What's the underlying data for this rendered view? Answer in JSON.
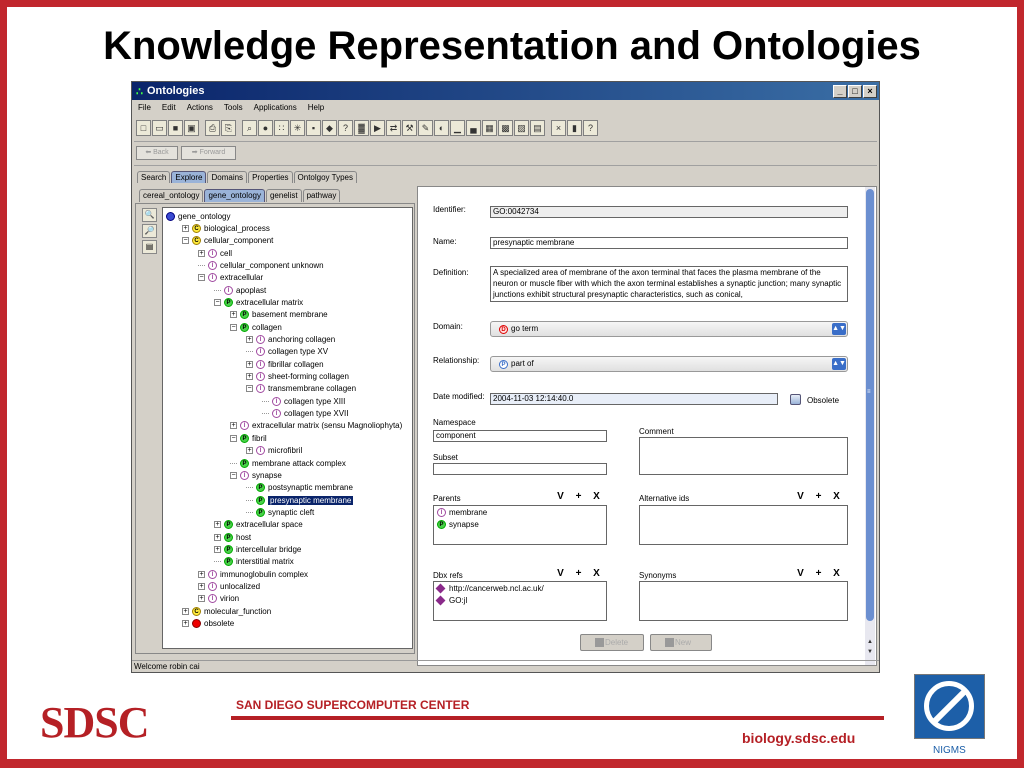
{
  "slide": {
    "title": "Knowledge Representation and Ontologies",
    "footer": {
      "org_abbrev": "SDSC",
      "org_name": "SAN DIEGO SUPERCOMPUTER CENTER",
      "url": "biology.sdsc.edu",
      "partner": "NIGMS"
    },
    "colors": {
      "brand_red": "#c1272d",
      "nigms_blue": "#1d5fa8"
    }
  },
  "window": {
    "title": "Ontologies",
    "menu": [
      "File",
      "Edit",
      "Actions",
      "Tools",
      "Applications",
      "Help"
    ],
    "toolbar_icons": [
      "new-icon",
      "open-icon",
      "save-icon",
      "save-all-icon",
      "print-icon",
      "copy-icon",
      "search-icon",
      "globe-icon",
      "tree-icon",
      "network-icon",
      "hierarchy-icon",
      "shapes-icon",
      "help-icon",
      "chart-icon",
      "import-icon",
      "export-icon",
      "tools-icon",
      "edit-icon",
      "terms-icon",
      "chart2-icon",
      "chart3-icon",
      "table-icon",
      "grid-icon",
      "image-icon",
      "doc-icon",
      "close-icon",
      "bookmark-icon",
      "help2-icon"
    ],
    "nav": {
      "back": "Back",
      "forward": "Forward"
    },
    "main_tabs": [
      "Search",
      "Explore",
      "Domains",
      "Properties",
      "Ontolgoy Types"
    ],
    "main_tab_selected": "Explore",
    "ontology_tabs": [
      "cereal_ontology",
      "gene_ontology",
      "genelist",
      "pathway"
    ],
    "ontology_tab_selected": "gene_ontology",
    "tree": [
      {
        "label": "gene_ontology",
        "type": "R",
        "depth": 0,
        "exp": ""
      },
      {
        "label": "biological_process",
        "type": "C",
        "depth": 1,
        "exp": "+"
      },
      {
        "label": "cellular_component",
        "type": "C",
        "depth": 1,
        "exp": "-"
      },
      {
        "label": "cell",
        "type": "I",
        "depth": 2,
        "exp": "+"
      },
      {
        "label": "cellular_component unknown",
        "type": "I",
        "depth": 2,
        "exp": ""
      },
      {
        "label": "extracellular",
        "type": "I",
        "depth": 2,
        "exp": "-"
      },
      {
        "label": "apoplast",
        "type": "I",
        "depth": 3,
        "exp": ""
      },
      {
        "label": "extracellular matrix",
        "type": "P",
        "depth": 3,
        "exp": "-"
      },
      {
        "label": "basement membrane",
        "type": "P",
        "depth": 4,
        "exp": "+"
      },
      {
        "label": "collagen",
        "type": "P",
        "depth": 4,
        "exp": "-"
      },
      {
        "label": "anchoring collagen",
        "type": "I",
        "depth": 5,
        "exp": "+"
      },
      {
        "label": "collagen type XV",
        "type": "I",
        "depth": 5,
        "exp": ""
      },
      {
        "label": "fibrillar collagen",
        "type": "I",
        "depth": 5,
        "exp": "+"
      },
      {
        "label": "sheet-forming collagen",
        "type": "I",
        "depth": 5,
        "exp": "+"
      },
      {
        "label": "transmembrane collagen",
        "type": "I",
        "depth": 5,
        "exp": "-"
      },
      {
        "label": "collagen type XIII",
        "type": "I",
        "depth": 6,
        "exp": ""
      },
      {
        "label": "collagen type XVII",
        "type": "I",
        "depth": 6,
        "exp": ""
      },
      {
        "label": "extracellular matrix (sensu Magnoliophyta)",
        "type": "I",
        "depth": 4,
        "exp": "+"
      },
      {
        "label": "fibril",
        "type": "P",
        "depth": 4,
        "exp": "-"
      },
      {
        "label": "microfibril",
        "type": "I",
        "depth": 5,
        "exp": "+"
      },
      {
        "label": "membrane attack complex",
        "type": "P",
        "depth": 4,
        "exp": ""
      },
      {
        "label": "synapse",
        "type": "I",
        "depth": 4,
        "exp": "-"
      },
      {
        "label": "postsynaptic membrane",
        "type": "P",
        "depth": 5,
        "exp": ""
      },
      {
        "label": "presynaptic membrane",
        "type": "P",
        "depth": 5,
        "exp": "",
        "selected": true
      },
      {
        "label": "synaptic cleft",
        "type": "P",
        "depth": 5,
        "exp": ""
      },
      {
        "label": "extracellular space",
        "type": "P",
        "depth": 3,
        "exp": "+"
      },
      {
        "label": "host",
        "type": "P",
        "depth": 3,
        "exp": "+"
      },
      {
        "label": "intercellular bridge",
        "type": "P",
        "depth": 3,
        "exp": "+"
      },
      {
        "label": "interstitial matrix",
        "type": "P",
        "depth": 3,
        "exp": ""
      },
      {
        "label": "immunoglobulin complex",
        "type": "I",
        "depth": 2,
        "exp": "+"
      },
      {
        "label": "unlocalized",
        "type": "I",
        "depth": 2,
        "exp": "+"
      },
      {
        "label": "virion",
        "type": "I",
        "depth": 2,
        "exp": "+"
      },
      {
        "label": "molecular_function",
        "type": "C",
        "depth": 1,
        "exp": "+"
      },
      {
        "label": "obsolete",
        "type": "O",
        "depth": 1,
        "exp": "+"
      }
    ],
    "detail": {
      "identifier_label": "Identifier:",
      "identifier": "GO:0042734",
      "name_label": "Name:",
      "name": "presynaptic membrane",
      "definition_label": "Definition:",
      "definition": "A specialized area of membrane of the axon terminal that faces the plasma membrane of the neuron or muscle fiber with which the axon terminal establishes a synaptic junction; many synaptic junctions exhibit structural presynaptic characteristics, such as conical,",
      "domain_label": "Domain:",
      "domain_icon": "D",
      "domain": "go term",
      "relationship_label": "Relationship:",
      "relationship_icon": "P",
      "relationship": "part of",
      "date_label": "Date modified:",
      "date": "2004-11-03 12:14:40.0",
      "obsolete_label": "Obsolete",
      "namespace_label": "Namespace",
      "namespace": "component",
      "comment_label": "Comment",
      "comment": "",
      "subset_label": "Subset",
      "subset": "",
      "parents_label": "Parents",
      "parents": [
        {
          "label": "membrane",
          "type": "I"
        },
        {
          "label": "synapse",
          "type": "P"
        }
      ],
      "alt_ids_label": "Alternative ids",
      "dbx_label": "Dbx refs",
      "dbx": [
        "http://cancerweb.ncl.ac.uk/",
        "GO:jl"
      ],
      "synonyms_label": "Synonyms",
      "list_btns": [
        "V",
        "+",
        "X"
      ],
      "delete": "Delete",
      "new": "New"
    },
    "status": "Welcome robin cai"
  }
}
